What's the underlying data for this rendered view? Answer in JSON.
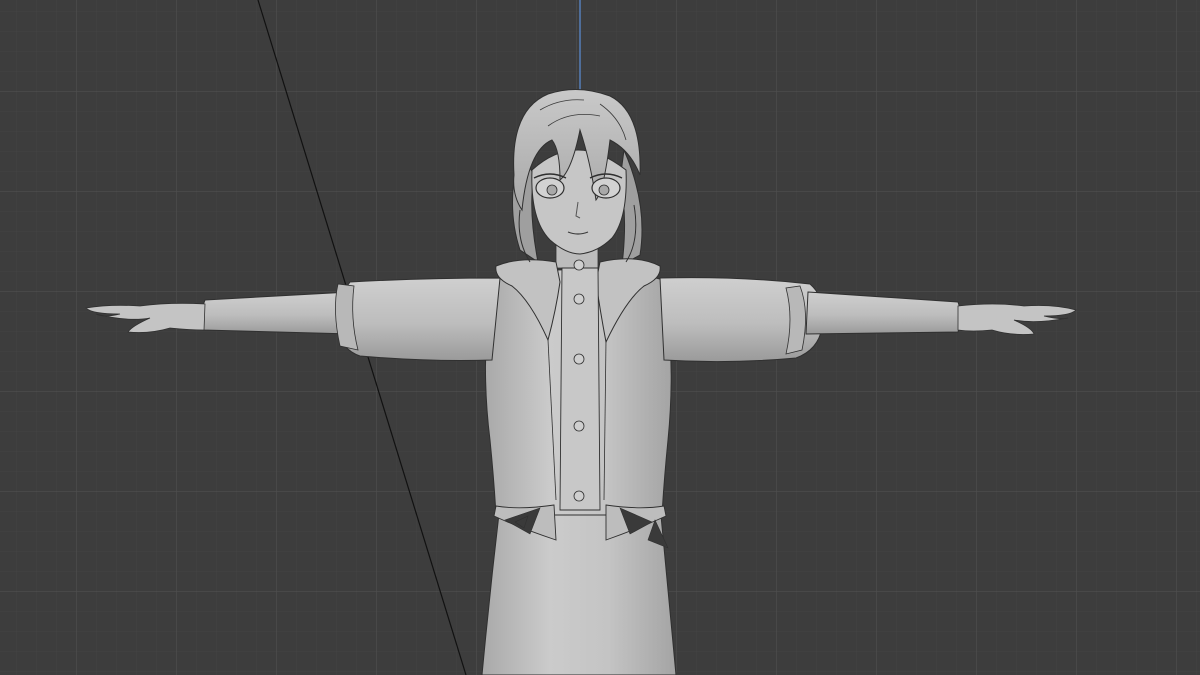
{
  "viewport": {
    "view": "front-orthographic",
    "shading": "solid",
    "colors": {
      "background": "#3d3d3d",
      "grid_minor": "#444444",
      "grid_major": "#4f4f4f",
      "z_axis": "#5b8fd8",
      "model": "#c6c6c6",
      "model_shadow": "#8e8e8e",
      "outline": "#2e2e2e"
    },
    "objects": [
      {
        "name": "character-mesh",
        "pose": "t-pose"
      },
      {
        "name": "bone-line"
      }
    ]
  }
}
